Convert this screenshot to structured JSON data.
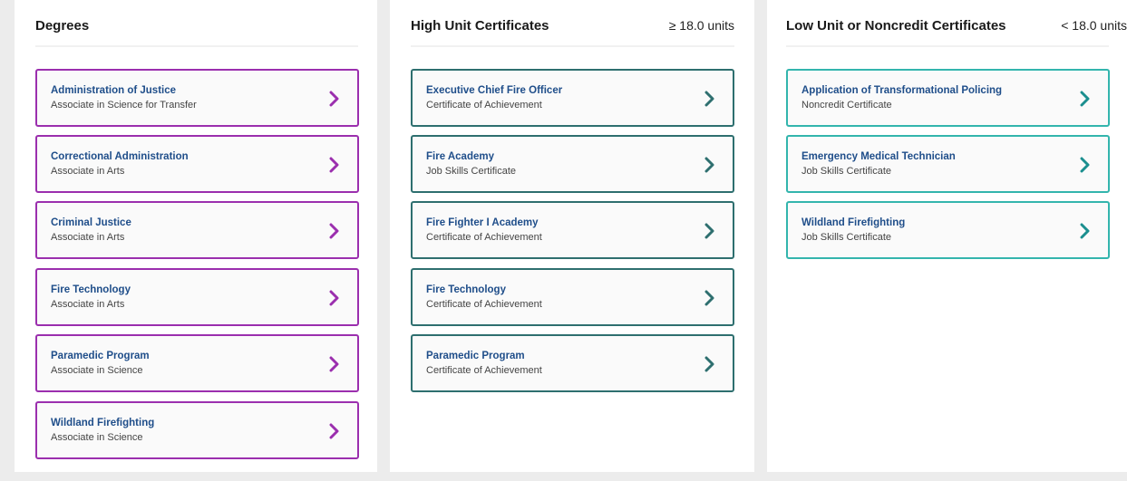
{
  "colors": {
    "degrees_border": "#9b2fae",
    "high_border": "#2e6f6f",
    "low_border": "#33b5ad",
    "title_text": "#1f4e8a"
  },
  "degrees": {
    "title": "Degrees",
    "items": [
      {
        "title": "Administration of Justice",
        "subtitle": "Associate in Science for Transfer"
      },
      {
        "title": "Correctional Administration",
        "subtitle": "Associate in Arts"
      },
      {
        "title": "Criminal Justice",
        "subtitle": "Associate in Arts"
      },
      {
        "title": "Fire Technology",
        "subtitle": "Associate in Arts"
      },
      {
        "title": "Paramedic Program",
        "subtitle": "Associate in Science"
      },
      {
        "title": "Wildland Firefighting",
        "subtitle": "Associate in Science"
      }
    ]
  },
  "high_unit": {
    "title": "High Unit Certificates",
    "units": "≥ 18.0 units",
    "items": [
      {
        "title": "Executive Chief Fire Officer",
        "subtitle": "Certificate of Achievement"
      },
      {
        "title": "Fire Academy",
        "subtitle": "Job Skills Certificate"
      },
      {
        "title": "Fire Fighter I Academy",
        "subtitle": "Certificate of Achievement"
      },
      {
        "title": "Fire Technology",
        "subtitle": "Certificate of Achievement"
      },
      {
        "title": "Paramedic Program",
        "subtitle": "Certificate of Achievement"
      }
    ]
  },
  "low_unit": {
    "title": "Low Unit or Noncredit Certificates",
    "units": "< 18.0 units",
    "items": [
      {
        "title": "Application of Transformational Policing",
        "subtitle": "Noncredit Certificate"
      },
      {
        "title": "Emergency Medical Technician",
        "subtitle": "Job Skills Certificate"
      },
      {
        "title": "Wildland Firefighting",
        "subtitle": "Job Skills Certificate"
      }
    ]
  }
}
